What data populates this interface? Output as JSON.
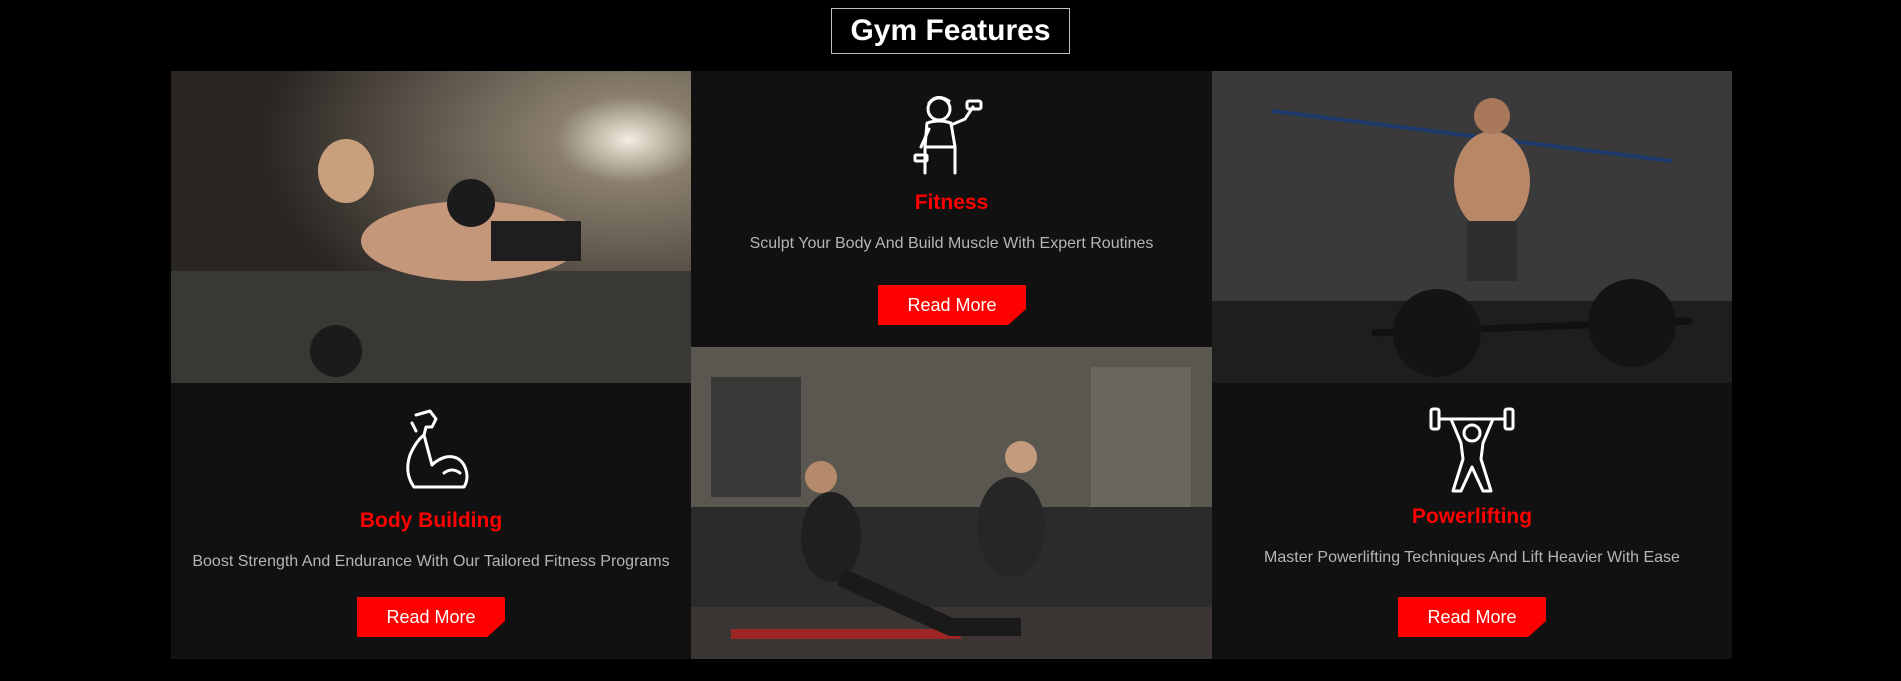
{
  "section": {
    "title": "Gym Features"
  },
  "features": [
    {
      "title": "Fitness",
      "description": "Sculpt Your Body And Build Muscle With Expert Routines",
      "button": "Read More"
    },
    {
      "title": "Body Building",
      "description": "Boost Strength And Endurance With Our Tailored Fitness Programs",
      "button": "Read More"
    },
    {
      "title": "Powerlifting",
      "description": "Master Powerlifting Techniques And Lift Heavier With Ease",
      "button": "Read More"
    }
  ],
  "colors": {
    "accent": "#ff0000",
    "panel": "#111111",
    "background": "#000000",
    "text_muted": "#b5b5b5"
  },
  "icons": [
    "woman-dumbbell-icon",
    "flexed-arm-icon",
    "weightlifter-icon"
  ],
  "images": [
    "man-pushup-dumbbell-photo",
    "woman-situp-trainer-photo",
    "man-barbell-deadlift-photo"
  ]
}
